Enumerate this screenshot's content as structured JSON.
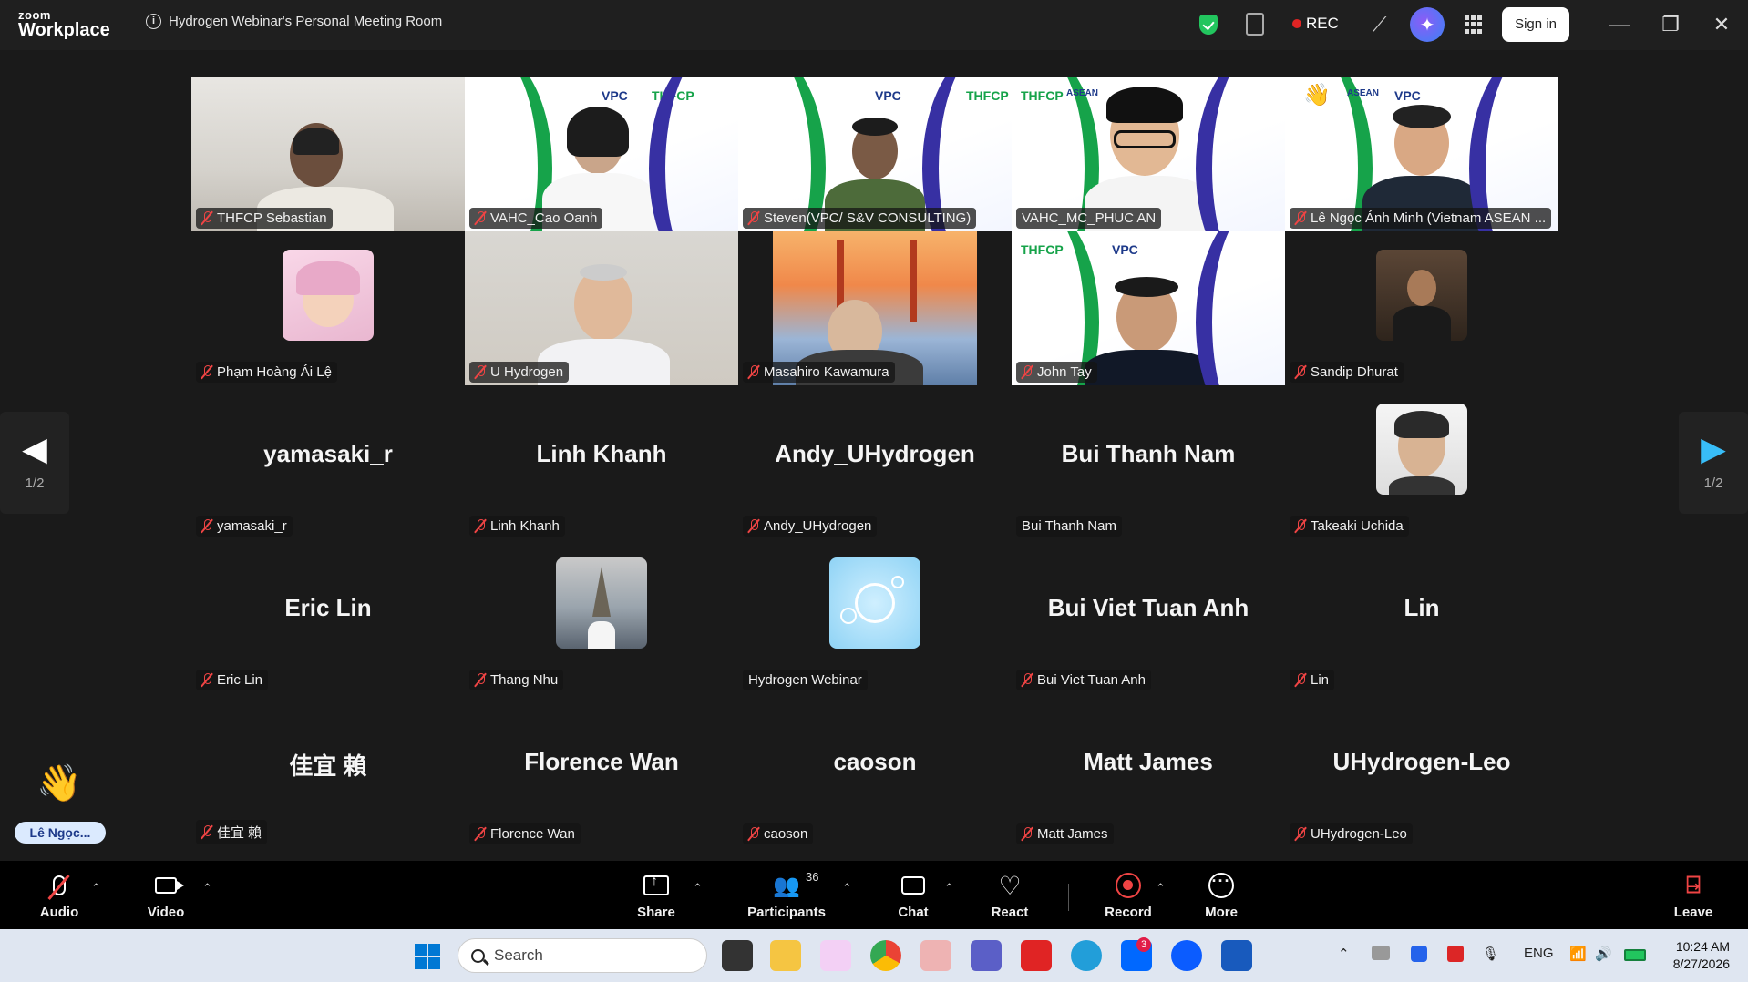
{
  "app": {
    "logo_top": "zoom",
    "logo_bottom": "Workplace",
    "meeting_title": "Hydrogen Webinar's Personal Meeting Room",
    "rec_label": "REC",
    "signin_label": "Sign in",
    "min_glyph": "—",
    "max_glyph": "❐",
    "close_glyph": "✕"
  },
  "banner": {
    "left_logo": "THFCP",
    "mid_logo": "ASEAN",
    "right_logo": "VPC"
  },
  "tiles": [
    {
      "name": "THFCP Sebastian",
      "muted": true
    },
    {
      "name": "VAHC_Cao Oanh",
      "muted": true
    },
    {
      "name": "Steven(VPC/ S&V CONSULTING)",
      "muted": true
    },
    {
      "name": "VAHC_MC_PHUC AN",
      "muted": false
    },
    {
      "name": "Lê Ngọc Ánh Minh (Vietnam ASEAN ...",
      "muted": true
    },
    {
      "name": "Phạm Hoàng Ái Lệ",
      "muted": true
    },
    {
      "name": "U Hydrogen",
      "muted": true
    },
    {
      "name": "Masahiro Kawamura",
      "muted": true
    },
    {
      "name": "John Tay",
      "muted": true
    },
    {
      "name": "Sandip Dhurat",
      "muted": true
    },
    {
      "name": "yamasaki_r",
      "big": "yamasaki_r",
      "muted": true
    },
    {
      "name": "Linh Khanh",
      "big": "Linh Khanh",
      "muted": true
    },
    {
      "name": "Andy_UHydrogen",
      "big": "Andy_UHydrogen",
      "muted": true
    },
    {
      "name": "Bui Thanh Nam",
      "big": "Bui Thanh Nam",
      "muted": false
    },
    {
      "name": "Takeaki Uchida",
      "muted": true
    },
    {
      "name": "Eric Lin",
      "big": "Eric Lin",
      "muted": true
    },
    {
      "name": "Thang Nhu",
      "muted": true
    },
    {
      "name": "Hydrogen Webinar",
      "muted": false
    },
    {
      "name": "Bui Viet Tuan Anh",
      "big": "Bui Viet Tuan Anh",
      "muted": true
    },
    {
      "name": "Lin",
      "big": "Lin",
      "muted": true
    },
    {
      "name": "佳宜 賴",
      "big": "佳宜 賴",
      "muted": true
    },
    {
      "name": "Florence Wan",
      "big": "Florence Wan",
      "muted": true
    },
    {
      "name": "caoson",
      "big": "caoson",
      "muted": true
    },
    {
      "name": "Matt James",
      "big": "Matt James",
      "muted": true
    },
    {
      "name": "UHydrogen-Leo",
      "big": "UHydrogen-Leo",
      "muted": true
    }
  ],
  "pager": {
    "left": "1/2",
    "right": "1/2"
  },
  "raised_hand": {
    "name": "Lê Ngọc..."
  },
  "toolbar": {
    "audio": "Audio",
    "video": "Video",
    "share": "Share",
    "participants": "Participants",
    "participants_count": "36",
    "chat": "Chat",
    "react": "React",
    "record": "Record",
    "more": "More",
    "leave": "Leave"
  },
  "taskbar": {
    "search_placeholder": "Search",
    "zalo_badge": "3",
    "lang": "ENG",
    "time": "10:24 AM",
    "date": "8/27/2026"
  }
}
